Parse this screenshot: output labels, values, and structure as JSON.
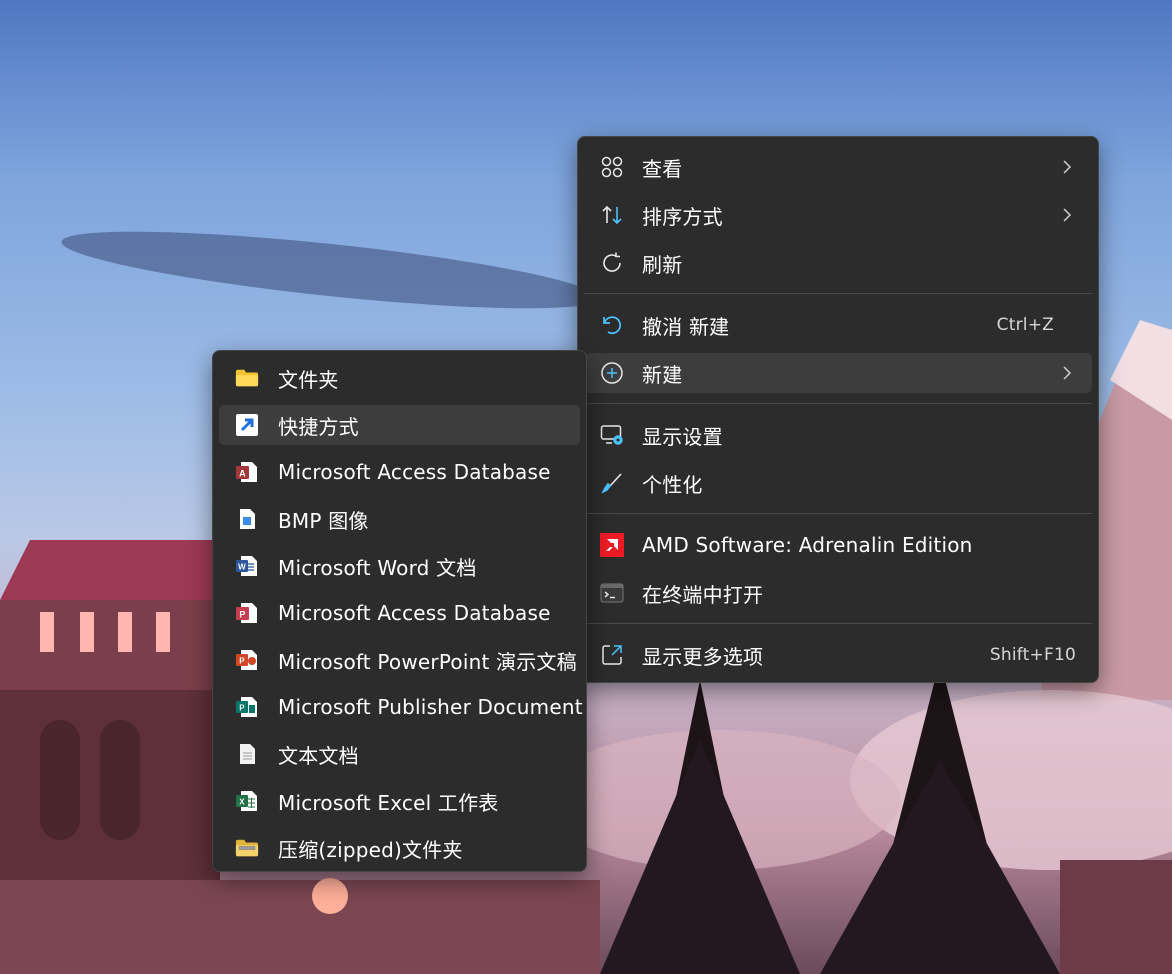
{
  "context_menu": {
    "items": [
      {
        "label": "查看",
        "icon": "grid-view-icon",
        "has_submenu": true
      },
      {
        "label": "排序方式",
        "icon": "sort-icon",
        "has_submenu": true
      },
      {
        "label": "刷新",
        "icon": "refresh-icon",
        "has_submenu": false
      },
      {
        "label": "撤消 新建",
        "icon": "undo-icon",
        "shortcut": "Ctrl+Z"
      },
      {
        "label": "新建",
        "icon": "new-plus-icon",
        "has_submenu": true,
        "highlighted": true
      },
      {
        "label": "显示设置",
        "icon": "display-settings-icon"
      },
      {
        "label": "个性化",
        "icon": "brush-icon"
      },
      {
        "label": "AMD Software: Adrenalin Edition",
        "icon": "amd-icon"
      },
      {
        "label": "在终端中打开",
        "icon": "terminal-icon"
      },
      {
        "label": "显示更多选项",
        "icon": "more-options-icon",
        "shortcut": "Shift+F10"
      }
    ]
  },
  "new_submenu": {
    "items": [
      {
        "label": "文件夹",
        "icon": "folder-icon"
      },
      {
        "label": "快捷方式",
        "icon": "shortcut-icon",
        "highlighted": true
      },
      {
        "label": "Microsoft Access Database",
        "icon": "access-icon"
      },
      {
        "label": "BMP 图像",
        "icon": "bmp-image-icon"
      },
      {
        "label": "Microsoft Word 文档",
        "icon": "word-icon"
      },
      {
        "label": "Microsoft Access Database",
        "icon": "access-icon"
      },
      {
        "label": "Microsoft PowerPoint 演示文稿",
        "icon": "powerpoint-icon"
      },
      {
        "label": "Microsoft Publisher Document",
        "icon": "publisher-icon"
      },
      {
        "label": "文本文档",
        "icon": "text-document-icon"
      },
      {
        "label": "Microsoft Excel 工作表",
        "icon": "excel-icon"
      },
      {
        "label": "压缩(zipped)文件夹",
        "icon": "zip-folder-icon"
      }
    ]
  },
  "colors": {
    "menu_bg": "#2c2c2c",
    "highlight": "#3d3d3d",
    "accent_blue": "#4cc2ff",
    "amd_red": "#ed1c24"
  }
}
